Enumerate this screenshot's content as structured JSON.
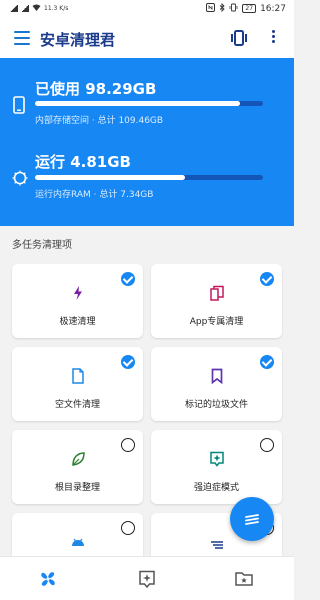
{
  "status_bar": {
    "network_speed": "11.3 K/s",
    "time": "16:27",
    "battery": "27"
  },
  "app": {
    "title": "安卓清理君"
  },
  "storage": {
    "title": "已使用 98.29GB",
    "subtitle": "内部存储空间 · 总计 109.46GB",
    "progress": 0.9
  },
  "ram": {
    "title": "运行 4.81GB",
    "subtitle": "运行内存RAM · 总计 7.34GB",
    "progress": 0.66
  },
  "section": {
    "title": "多任务清理项"
  },
  "cards": [
    {
      "label": "极速清理",
      "icon": "lightning-icon",
      "checked": true
    },
    {
      "label": "App专属清理",
      "icon": "app-tiles-icon",
      "checked": true
    },
    {
      "label": "空文件清理",
      "icon": "empty-file-icon",
      "checked": true
    },
    {
      "label": "标记的垃圾文件",
      "icon": "bookmark-icon",
      "checked": true
    },
    {
      "label": "根目录整理",
      "icon": "leaf-icon",
      "checked": false
    },
    {
      "label": "强迫症模式",
      "icon": "sparkle-box-icon",
      "checked": false
    },
    {
      "label": "",
      "icon": "android-icon",
      "checked": false
    },
    {
      "label": "",
      "icon": "lines-icon",
      "checked": false
    }
  ],
  "colors": {
    "primary": "#1687f3",
    "title_text": "#1a3a8a",
    "lightning": "#7b1fa2",
    "apps": "#c2185b",
    "file": "#1e88e5",
    "bookmark": "#5e35b1",
    "leaf": "#2e7d32",
    "sparkle": "#00897b"
  }
}
